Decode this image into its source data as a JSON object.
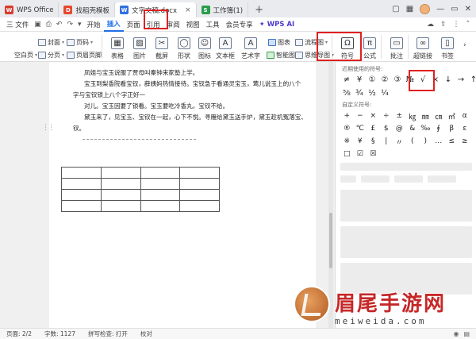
{
  "titlebar": {
    "tabs": [
      {
        "label": "WPS Office",
        "logo": "W",
        "logo_color": "#d83b2d"
      },
      {
        "label": "找稻壳模板",
        "logo": "D",
        "logo_color": "#e8472f"
      },
      {
        "label": "文字文稿.docx",
        "logo": "W",
        "logo_color": "#2f6fe0"
      },
      {
        "label": "工作簿(1)",
        "logo": "S",
        "logo_color": "#2a9d4a"
      }
    ],
    "new_tab": "+"
  },
  "menubar": {
    "file_label": "三 文件",
    "items": [
      "开始",
      "插入",
      "页面",
      "引用",
      "审阅",
      "视图",
      "工具",
      "会员专享"
    ],
    "active_index": 1,
    "ai_label": "WPS AI"
  },
  "ribbon": {
    "blank_page": "空白页",
    "section": "分页",
    "cover": "封面",
    "page_number": "页码",
    "header_footer": "页眉页脚",
    "table": "表格",
    "picture": "图片",
    "screenshot": "截屏",
    "shape": "形状",
    "icon": "图标",
    "textbox": "文本框",
    "wordart": "艺术字",
    "chart": "图表",
    "smart_shape": "智能图形",
    "flowchart": "流程图",
    "mindmap": "思维导图",
    "symbol": "符号",
    "symbol_glyph": "Ω",
    "formula": "公式",
    "comment": "批注",
    "hyperlink": "超链接",
    "bookmark": "书签"
  },
  "document": {
    "paragraphs": [
      "凤姐与宝玉说服了贾母叫秦钟来家塾上学。",
      "宝玉到梨香院看宝钗，薛姨妈热情接待。宝钗急于看通灵宝玉，莺儿说玉上的八个",
      "字与宝钗锁上八个字正好一",
      "对儿。宝玉因要了锁看。宝玉要吃冷香丸，宝钗不给。",
      "黛玉来了，见宝玉、宝钗在一起，心下不悦。寻雁给黛玉送手炉，黛玉趁机冤落宝、",
      "钗。"
    ]
  },
  "symbol_panel": {
    "recent_title": "近期使用的符号:",
    "recent_row1": [
      "≠",
      "¥",
      "①",
      "②",
      "③",
      "№",
      "√",
      "×",
      "↓",
      "→",
      "↑"
    ],
    "recent_row2": [
      "⅝",
      "¾",
      "½",
      "¼"
    ],
    "custom_title": "自定义符号:",
    "custom_symbols": [
      "+",
      "−",
      "×",
      "÷",
      "±",
      "㎏",
      "㎜",
      "㎝",
      "㎡",
      "α",
      "®",
      "℃",
      "£",
      "$",
      "@",
      "&",
      "‰",
      "∮",
      "β",
      "ε",
      "※",
      "¥",
      "§",
      "|",
      "〃",
      "(",
      ")",
      "…",
      "≤",
      "≥",
      "□",
      "☑",
      "☒"
    ]
  },
  "statusbar": {
    "page": "页面: 2/2",
    "words": "字数: 1127",
    "spell": "拼写检查: 打开",
    "proofread": "校对"
  },
  "watermark": {
    "title": "眉尾手游网",
    "url": "meiweida.com"
  }
}
